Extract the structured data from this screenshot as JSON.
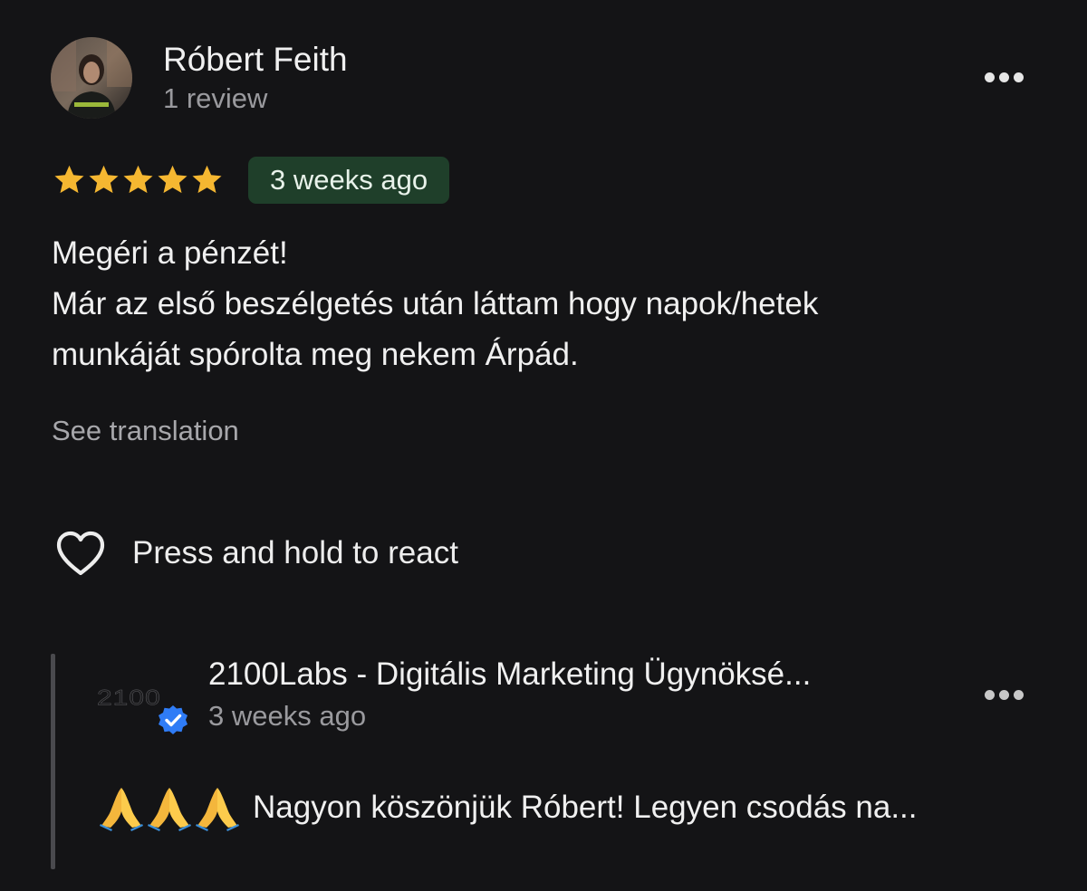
{
  "review": {
    "author": {
      "name": "Róbert Feith",
      "meta": "1 review",
      "avatar_icon": "person-avatar"
    },
    "more_icon": "more-horizontal-icon",
    "rating": 5,
    "rating_max": 5,
    "star_color": "#F5B731",
    "time_badge": "3 weeks ago",
    "badge_color": "#1F3F2A",
    "text_lines": [
      "Megéri a pénzét!",
      "Már az első beszélgetés után láttam hogy napok/hetek",
      "munkáját spórolta meg nekem Árpád."
    ],
    "see_translation": "See translation",
    "react": {
      "icon": "heart-icon",
      "label": "Press and hold to react"
    }
  },
  "reply": {
    "owner_name": "2100Labs - Digitális Marketing Ügynöksé...",
    "owner_logo_text": "2100",
    "verified_icon": "verified-badge-icon",
    "verified_color": "#2F7CF6",
    "meta": "3 weeks ago",
    "emoji_icons": [
      "folded-hands-emoji",
      "folded-hands-emoji",
      "folded-hands-emoji"
    ],
    "text": "Nagyon köszönjük Róbert! Legyen csodás na..."
  }
}
